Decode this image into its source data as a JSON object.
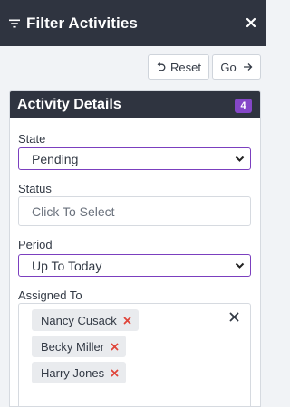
{
  "header": {
    "title": "Filter Activities",
    "icon": "filter-icon",
    "close_icon": "close-icon"
  },
  "toolbar": {
    "reset_label": "Reset",
    "reset_icon": "undo-icon",
    "go_label": "Go",
    "go_icon": "arrow-right-icon"
  },
  "panel": {
    "title": "Activity Details",
    "badge": "4",
    "badge_color": "#8547c8"
  },
  "fields": {
    "state": {
      "label": "State",
      "value": "Pending"
    },
    "status": {
      "label": "Status",
      "placeholder": "Click To Select"
    },
    "period": {
      "label": "Period",
      "value": "Up To Today"
    },
    "assigned": {
      "label": "Assigned To",
      "tags": [
        "Nancy Cusack",
        "Becky Miller",
        "Harry Jones"
      ]
    }
  },
  "colors": {
    "header_bg": "#2f3440",
    "accent": "#7b3fbf",
    "remove_x": "#e0453a",
    "page_bg": "#f1f3f6"
  }
}
